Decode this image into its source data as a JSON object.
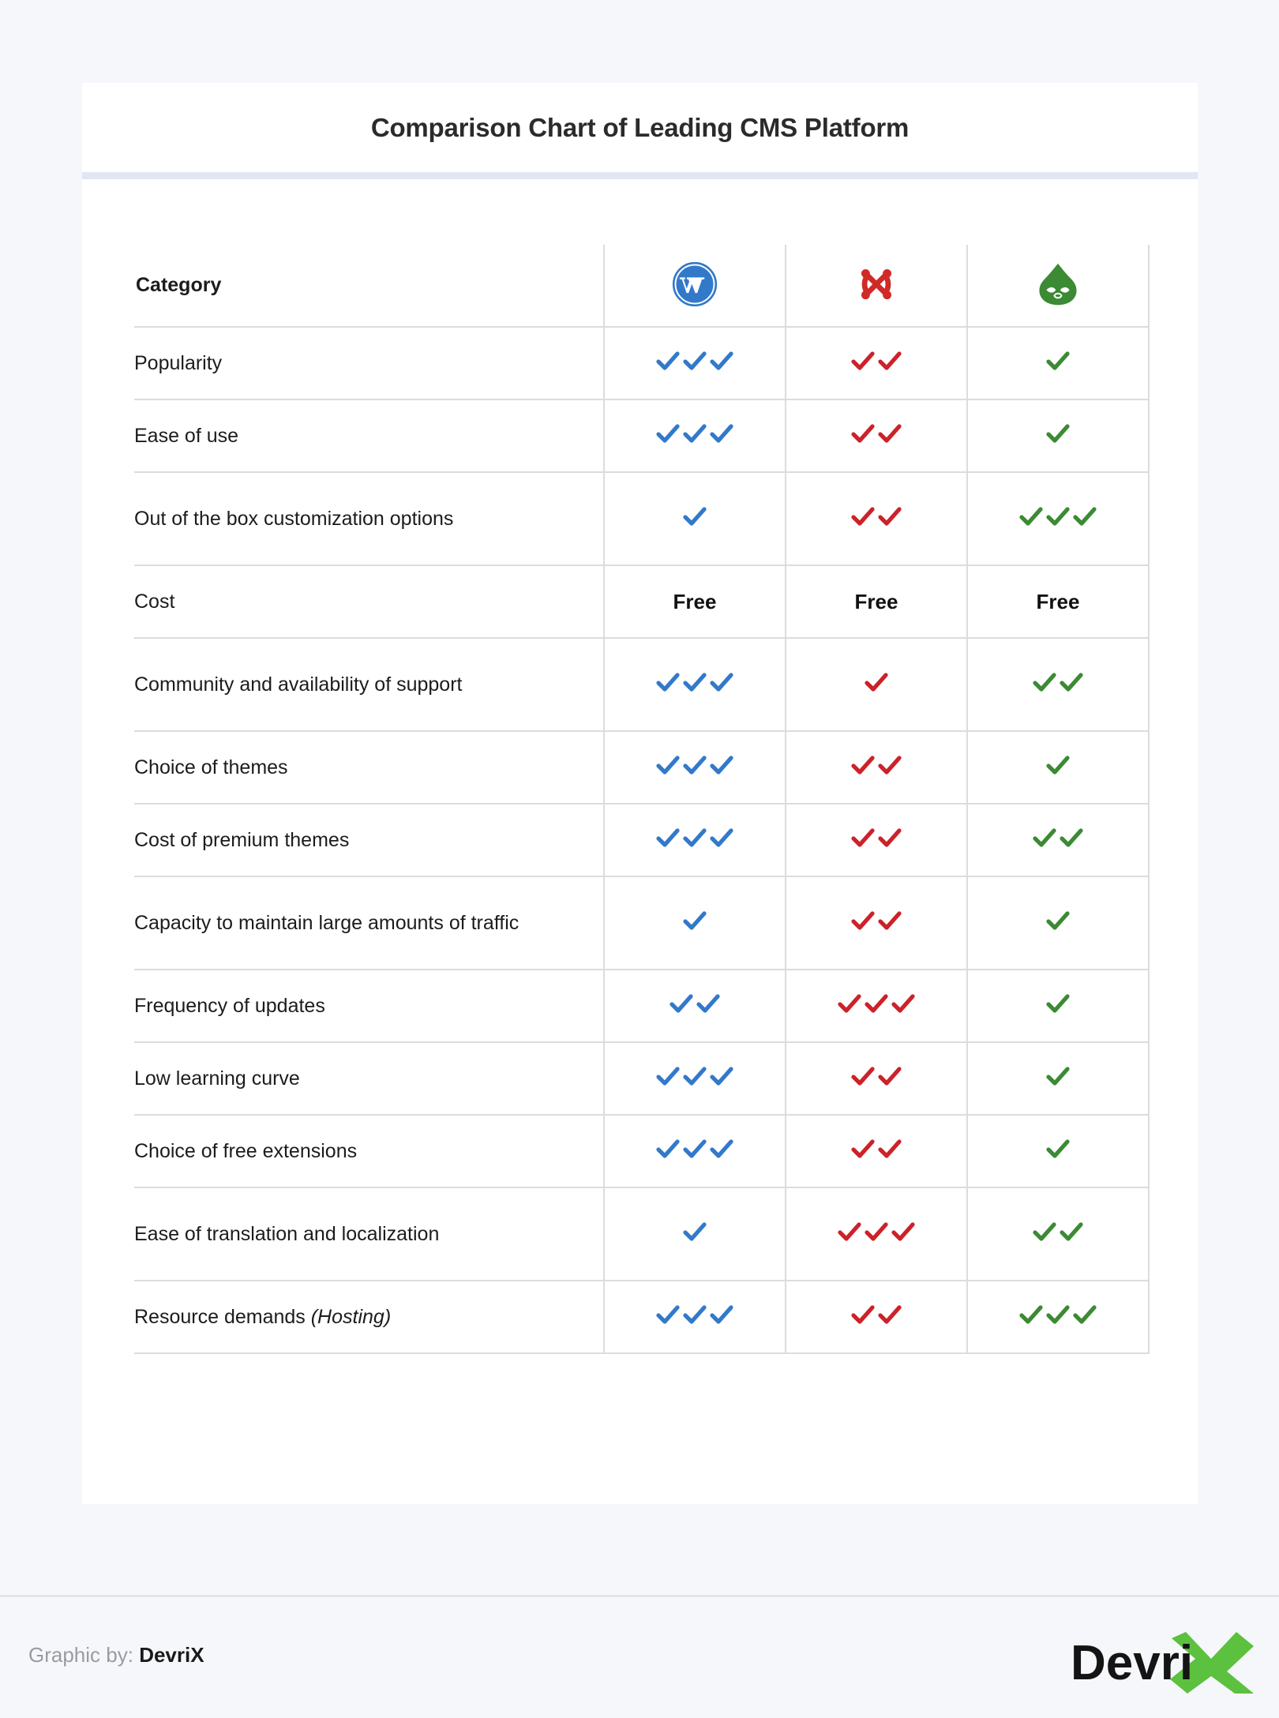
{
  "title": "Comparison Chart of Leading CMS Platform",
  "table": {
    "category_header": "Category",
    "platforms": [
      {
        "name": "WordPress",
        "icon": "wordpress-logo",
        "color": "#3279CA"
      },
      {
        "name": "Joomla",
        "icon": "joomla-logo",
        "color": "#D12A26"
      },
      {
        "name": "Drupal",
        "icon": "drupal-logo",
        "color": "#3C8A33"
      }
    ],
    "rows": [
      {
        "category": "Popularity",
        "wordpress": 3,
        "joomla": 2,
        "drupal": 1
      },
      {
        "category": "Ease of use",
        "wordpress": 3,
        "joomla": 2,
        "drupal": 1
      },
      {
        "category": "Out of the box customization options",
        "wordpress": 1,
        "joomla": 2,
        "drupal": 3
      },
      {
        "category": "Cost",
        "wordpress_text": "Free",
        "joomla_text": "Free",
        "drupal_text": "Free"
      },
      {
        "category": "Community and availability of support",
        "wordpress": 3,
        "joomla": 1,
        "drupal": 2
      },
      {
        "category": "Choice of themes",
        "wordpress": 3,
        "joomla": 2,
        "drupal": 1
      },
      {
        "category": "Cost of premium themes",
        "wordpress": 3,
        "joomla": 2,
        "drupal": 2
      },
      {
        "category": "Capacity to maintain large amounts of traffic",
        "wordpress": 1,
        "joomla": 2,
        "drupal": 1
      },
      {
        "category": "Frequency of updates",
        "wordpress": 2,
        "joomla": 3,
        "drupal": 1
      },
      {
        "category": "Low learning curve",
        "wordpress": 3,
        "joomla": 2,
        "drupal": 1
      },
      {
        "category": "Choice of free extensions",
        "wordpress": 3,
        "joomla": 2,
        "drupal": 1
      },
      {
        "category": "Ease of translation and localization",
        "wordpress": 1,
        "joomla": 3,
        "drupal": 2
      },
      {
        "category": "Resource demands ",
        "category_italic": "(Hosting)",
        "wordpress": 3,
        "joomla": 2,
        "drupal": 3
      }
    ]
  },
  "footer": {
    "credit_label": "Graphic by:",
    "credit_name": "DevriX",
    "brand_text": "Devri",
    "brand_mark": "X",
    "brand_mark_color": "#5CC13E"
  },
  "colors": {
    "page_background": "#F6F7FB",
    "card_background": "#FFFFFF",
    "title_divider": "#E2E6F2",
    "grid_line": "#DCDCDC",
    "check_blue": "#3279CA",
    "check_red": "#CC2229",
    "check_green": "#3C8A33",
    "text_primary": "#1C1C1C"
  },
  "chart_data": {
    "type": "table",
    "title": "Comparison Chart of Leading CMS Platform",
    "xlabel": "",
    "ylabel": "",
    "columns": [
      "Category",
      "WordPress",
      "Joomla",
      "Drupal"
    ],
    "rating_scale": "checkmark count, 1 to 3",
    "rows": [
      [
        "Popularity",
        3,
        2,
        1
      ],
      [
        "Ease of use",
        3,
        2,
        1
      ],
      [
        "Out of the box customization options",
        1,
        2,
        3
      ],
      [
        "Cost",
        "Free",
        "Free",
        "Free"
      ],
      [
        "Community and availability of support",
        3,
        1,
        2
      ],
      [
        "Choice of themes",
        3,
        2,
        1
      ],
      [
        "Cost of premium themes",
        3,
        2,
        2
      ],
      [
        "Capacity to maintain large amounts of traffic",
        1,
        2,
        1
      ],
      [
        "Frequency of updates",
        2,
        3,
        1
      ],
      [
        "Low learning curve",
        3,
        2,
        1
      ],
      [
        "Choice of free extensions",
        3,
        2,
        1
      ],
      [
        "Ease of translation and localization",
        1,
        3,
        2
      ],
      [
        "Resource demands (Hosting)",
        3,
        2,
        3
      ]
    ],
    "series": [
      {
        "name": "WordPress",
        "values": [
          3,
          3,
          1,
          null,
          3,
          3,
          3,
          1,
          2,
          3,
          3,
          1,
          3
        ]
      },
      {
        "name": "Joomla",
        "values": [
          2,
          2,
          2,
          null,
          1,
          2,
          2,
          2,
          3,
          2,
          2,
          3,
          2
        ]
      },
      {
        "name": "Drupal",
        "values": [
          1,
          1,
          3,
          null,
          2,
          1,
          2,
          1,
          1,
          1,
          1,
          2,
          3
        ]
      }
    ],
    "legend_position": "header row (platform logos)",
    "grid": true
  }
}
